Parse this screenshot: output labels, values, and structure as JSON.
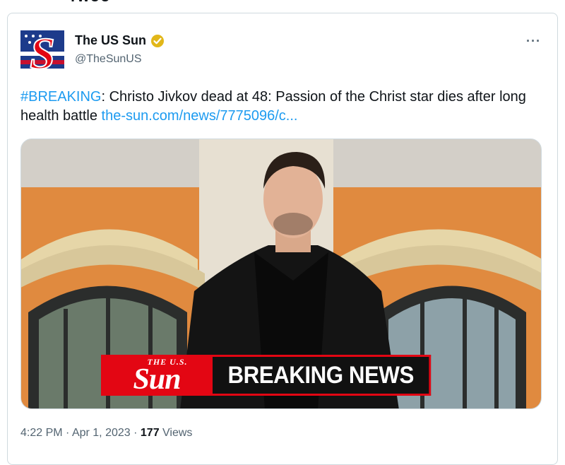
{
  "top_fragment": "rwoo",
  "author": {
    "name": "The US Sun",
    "handle": "@TheSunUS",
    "avatar_icon": "the-sun-s-logo-icon",
    "verified_icon": "verified-badge-icon"
  },
  "more_label": "···",
  "tweet": {
    "hashtag": "#BREAKING",
    "text": ": Christo Jivkov dead at 48: Passion of the Christ star dies after long health battle ",
    "link": "the-sun.com/news/7775096/c..."
  },
  "media": {
    "banner_small": "THE U.S.",
    "banner_logo": "Sun",
    "banner_text": "BREAKING NEWS"
  },
  "meta": {
    "time": "4:22 PM",
    "date": "Apr 1, 2023",
    "views_count": "177",
    "views_label": " Views"
  },
  "colors": {
    "link": "#1d9bf0",
    "verified": "#e2b719",
    "sun_red": "#e30613"
  }
}
